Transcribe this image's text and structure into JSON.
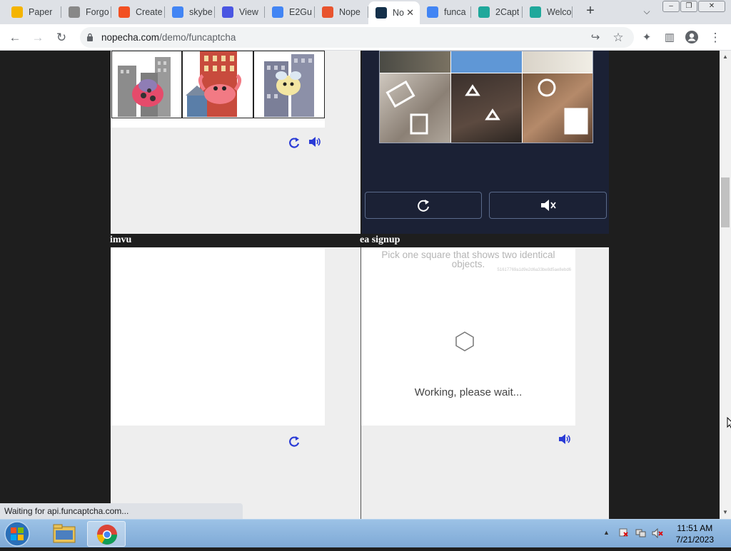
{
  "browser": {
    "tabs": [
      {
        "label": "Paper",
        "icon": "paper-icon",
        "color": "#f4b400"
      },
      {
        "label": "Forgo",
        "icon": "infinity-icon",
        "color": "#888888"
      },
      {
        "label": "Create",
        "icon": "microsoft-icon",
        "color": "#f25022"
      },
      {
        "label": "skybe",
        "icon": "google-icon",
        "color": "#4285f4"
      },
      {
        "label": "View",
        "icon": "at-icon",
        "color": "#4a56e2"
      },
      {
        "label": "E2Gu",
        "icon": "google-icon",
        "color": "#4285f4"
      },
      {
        "label": "Nope",
        "icon": "nopecha-icon",
        "color": "#e8542e"
      },
      {
        "label": "No",
        "icon": "nopecha-robot-icon",
        "color": "#14304a",
        "active": true
      },
      {
        "label": "funca",
        "icon": "google-icon",
        "color": "#4285f4"
      },
      {
        "label": "2Capt",
        "icon": "2captcha-icon",
        "color": "#1fa89b"
      },
      {
        "label": "Welco",
        "icon": "2captcha-icon",
        "color": "#1fa89b"
      }
    ],
    "url_host": "nopecha.com",
    "url_path": "/demo/funcaptcha",
    "status_text": "Waiting for api.funcaptcha.com..."
  },
  "page": {
    "sections": [
      {
        "label": "imvu"
      },
      {
        "label": "ea signup"
      }
    ],
    "ea_captcha": {
      "prompt": "Pick one square that shows two identical objects.",
      "session_id": "51617769a1d9e2d6a33be8d5ae8ebd6",
      "loading_text": "Working, please wait..."
    }
  },
  "taskbar": {
    "time": "11:51 AM",
    "date": "7/21/2023"
  }
}
